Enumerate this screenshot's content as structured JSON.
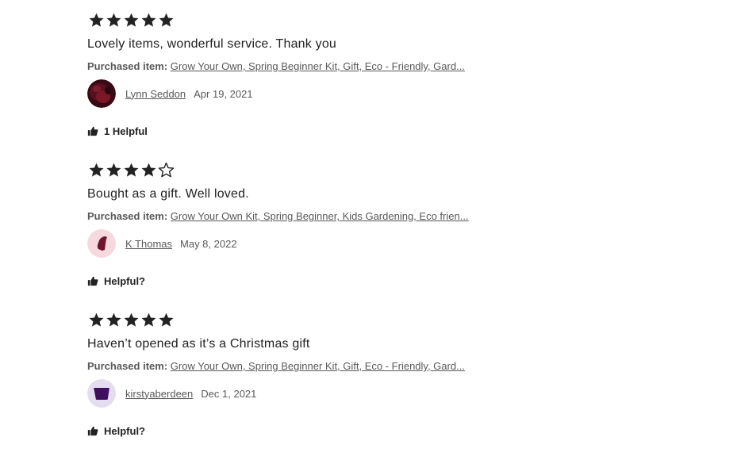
{
  "reviews": [
    {
      "rating": 5,
      "text": "Lovely items, wonderful service. Thank you",
      "purchased_label": "Purchased item:",
      "purchased_item": "Grow Your Own, Spring Beginner Kit, Gift, Eco - Friendly, Gard...",
      "reviewer": "Lynn Seddon",
      "date": "Apr 19, 2021",
      "helpful": "1 Helpful",
      "avatar_colors": [
        "#3a0a14",
        "#7a1828"
      ]
    },
    {
      "rating": 4,
      "text": "Bought as a gift. Well loved.",
      "purchased_label": "Purchased item:",
      "purchased_item": "Grow Your Own Kit, Spring Beginner, Kids Gardening, Eco frien...",
      "reviewer": "K Thomas",
      "date": "May 8, 2022",
      "helpful": "Helpful?",
      "avatar_colors": [
        "#f6d9df",
        "#6e1530"
      ]
    },
    {
      "rating": 5,
      "text": "Haven’t opened as it’s a Christmas gift",
      "purchased_label": "Purchased item:",
      "purchased_item": "Grow Your Own, Spring Beginner Kit, Gift, Eco - Friendly, Gard...",
      "reviewer": "kirstyaberdeen",
      "date": "Dec 1, 2021",
      "helpful": "Helpful?",
      "avatar_colors": [
        "#e4dcef",
        "#3d0f5c"
      ]
    }
  ],
  "icons": {
    "star_filled": "star-filled-icon",
    "star_empty": "star-empty-icon",
    "thumb": "thumbs-up-icon"
  },
  "colors": {
    "text": "#222222",
    "muted": "#595959",
    "star": "#222222"
  }
}
